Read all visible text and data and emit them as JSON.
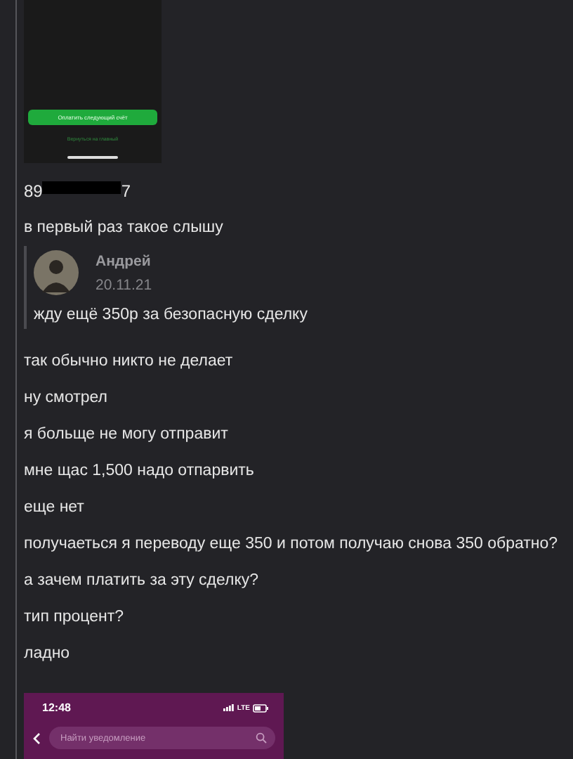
{
  "top_screenshot": {
    "button": "Оплатить следующий счёт",
    "link": "Вернуться на главный"
  },
  "messages": [
    {
      "kind": "phone",
      "prefix": "89",
      "suffix": "7"
    },
    {
      "kind": "text",
      "text": "в первый раз такое слышу"
    },
    {
      "kind": "quote",
      "author": "Андрей",
      "date": "20.11.21",
      "text": "жду ещё 350р за безопасную сделку"
    },
    {
      "kind": "text",
      "text": "так обычно никто не делает"
    },
    {
      "kind": "text",
      "text": "ну смотрел"
    },
    {
      "kind": "text",
      "text": "я больще не могу отправит"
    },
    {
      "kind": "text",
      "text": "мне щас 1,500 надо отпарвить"
    },
    {
      "kind": "text",
      "text": "еще нет"
    },
    {
      "kind": "text",
      "text": "получаеться я переводу еще 350 и потом получаю снова 350 обратно?"
    },
    {
      "kind": "text",
      "text": "а зачем платить за эту сделку?"
    },
    {
      "kind": "text",
      "text": "тип процент?"
    },
    {
      "kind": "text",
      "text": "ладно"
    }
  ],
  "bottom_screenshot": {
    "time": "12:48",
    "network": "LTE",
    "search": {
      "placeholder": "Найти уведомление"
    }
  }
}
